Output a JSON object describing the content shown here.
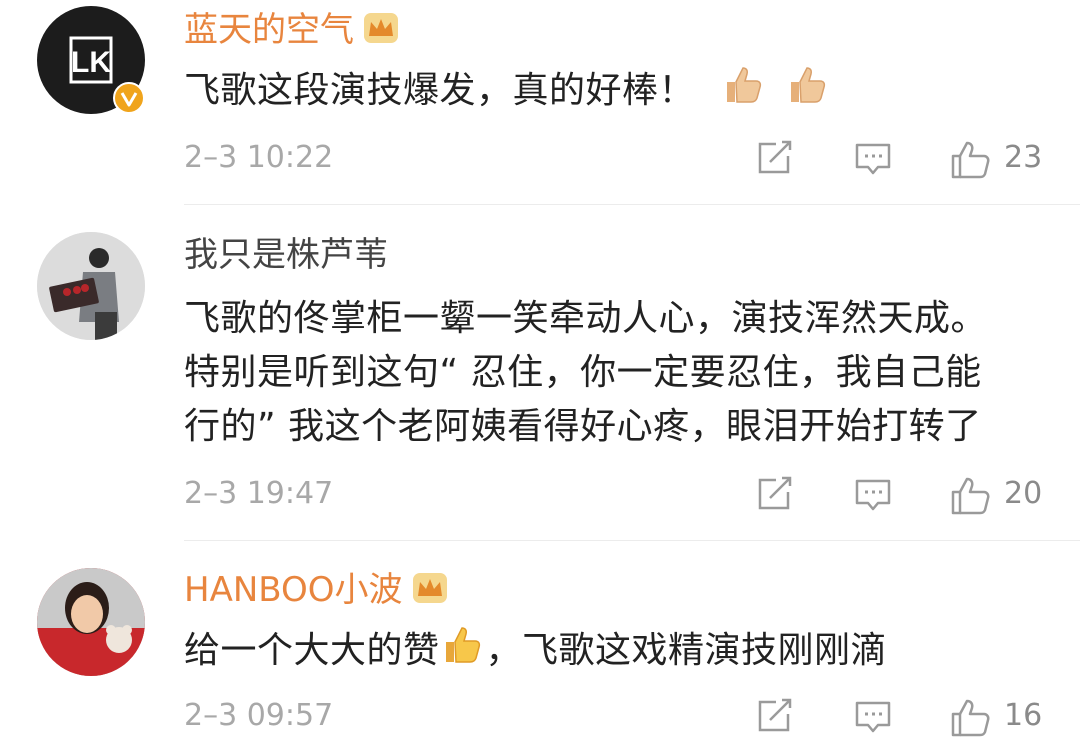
{
  "comments": [
    {
      "username": "蓝天的空气",
      "text": "飞歌这段演技爆发，真的好棒！",
      "time": "2–3 10:22",
      "likes": "23"
    },
    {
      "username": "我只是株芦苇",
      "text_lines": [
        "飞歌的佟掌柜一颦一笑牵动人心，演技浑然天成。",
        "特别是听到这句“ 忍住，你一定要忍住，我自己能",
        "行的” 我这个老阿姨看得好心疼，眼泪开始打转了"
      ],
      "time": "2–3 19:47",
      "likes": "20"
    },
    {
      "username": "HANBOO小波",
      "text_before": "给一个大大的赞",
      "text_after": "，飞歌这戏精演技刚刚滴",
      "time": "2–3 09:57",
      "likes": "16"
    }
  ],
  "avatar_logo_letters": "LK",
  "icons": [
    "crown-icon",
    "verified-badge-icon",
    "thumbs-up-emoji",
    "share-icon",
    "reply-icon",
    "like-icon"
  ],
  "colors": {
    "vip_name": "#e8853e",
    "meta": "#a8a8a8",
    "badge": "#f0a41c"
  }
}
